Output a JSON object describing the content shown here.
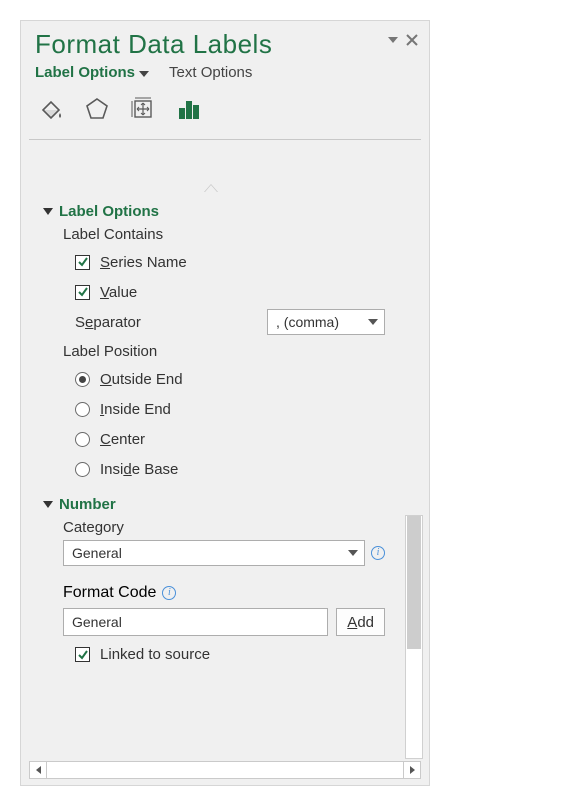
{
  "title": "Format Data Labels",
  "tabs": {
    "label_options": "Label Options",
    "text_options": "Text Options"
  },
  "sections": {
    "label_options": {
      "heading": "Label Options",
      "label_contains": "Label Contains",
      "series_name_pre": "S",
      "series_name_rest": "eries Name",
      "value_pre": "V",
      "value_rest": "alue",
      "separator_pre": "S",
      "separator_mid": "e",
      "separator_rest": "parator",
      "separator_value": ", (comma)",
      "label_position": "Label Position",
      "pos_outside_pre": "O",
      "pos_outside_rest": "utside End",
      "pos_insideend_pre": "I",
      "pos_insideend_rest": "nside End",
      "pos_center_pre": "C",
      "pos_center_rest": "enter",
      "pos_insidebase_pre": "Insi",
      "pos_insidebase_mid": "d",
      "pos_insidebase_rest": "e Base"
    },
    "number": {
      "heading": "Number",
      "category_pre": "C",
      "category_rest": "ategory",
      "category_value": "General",
      "format_code_pre": "Forma",
      "format_code_mid": "t",
      "format_code_rest": " Code",
      "format_code_value": "General",
      "add_pre": "A",
      "add_rest": "dd",
      "linked_pre": "L",
      "linked_mid": "i",
      "linked_rest": "nked to source"
    }
  }
}
